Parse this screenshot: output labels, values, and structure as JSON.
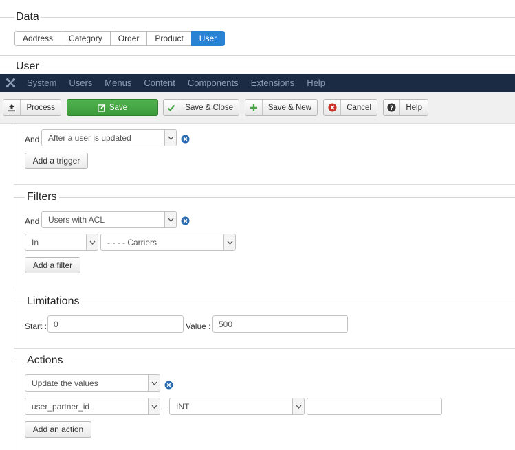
{
  "data_section": {
    "title": "Data",
    "tabs": [
      "Address",
      "Category",
      "Order",
      "Product",
      "User"
    ],
    "active_tab": "User"
  },
  "user_section": {
    "title": "User"
  },
  "navbar": {
    "logo_icon": "joomla-icon",
    "items": [
      "System",
      "Users",
      "Menus",
      "Content",
      "Components",
      "Extensions",
      "Help"
    ]
  },
  "toolbar": {
    "process": "Process",
    "save": "Save",
    "save_close": "Save & Close",
    "save_new": "Save & New",
    "cancel": "Cancel",
    "help": "Help"
  },
  "triggers": {
    "and_label": "And",
    "trigger_value": "After a user is updated",
    "add_button": "Add a trigger"
  },
  "filters": {
    "title": "Filters",
    "and_label": "And",
    "filter_value": "Users with ACL",
    "operator": "In",
    "group": "- - - - Carriers",
    "add_button": "Add a filter"
  },
  "limitations": {
    "title": "Limitations",
    "start_label": "Start :",
    "start_value": "0",
    "value_label": "Value :",
    "value_value": "500"
  },
  "actions": {
    "title": "Actions",
    "action_value": "Update the values",
    "field": "user_partner_id",
    "equals": "=",
    "type": "INT",
    "value": "",
    "add_button": "Add an action"
  },
  "colors": {
    "active_tab": "#2a82d4",
    "navbar_bg": "#1b2b44",
    "save_button": "#46a546",
    "remove_icon": "#2a6db5",
    "cancel_icon": "#c9302c"
  }
}
